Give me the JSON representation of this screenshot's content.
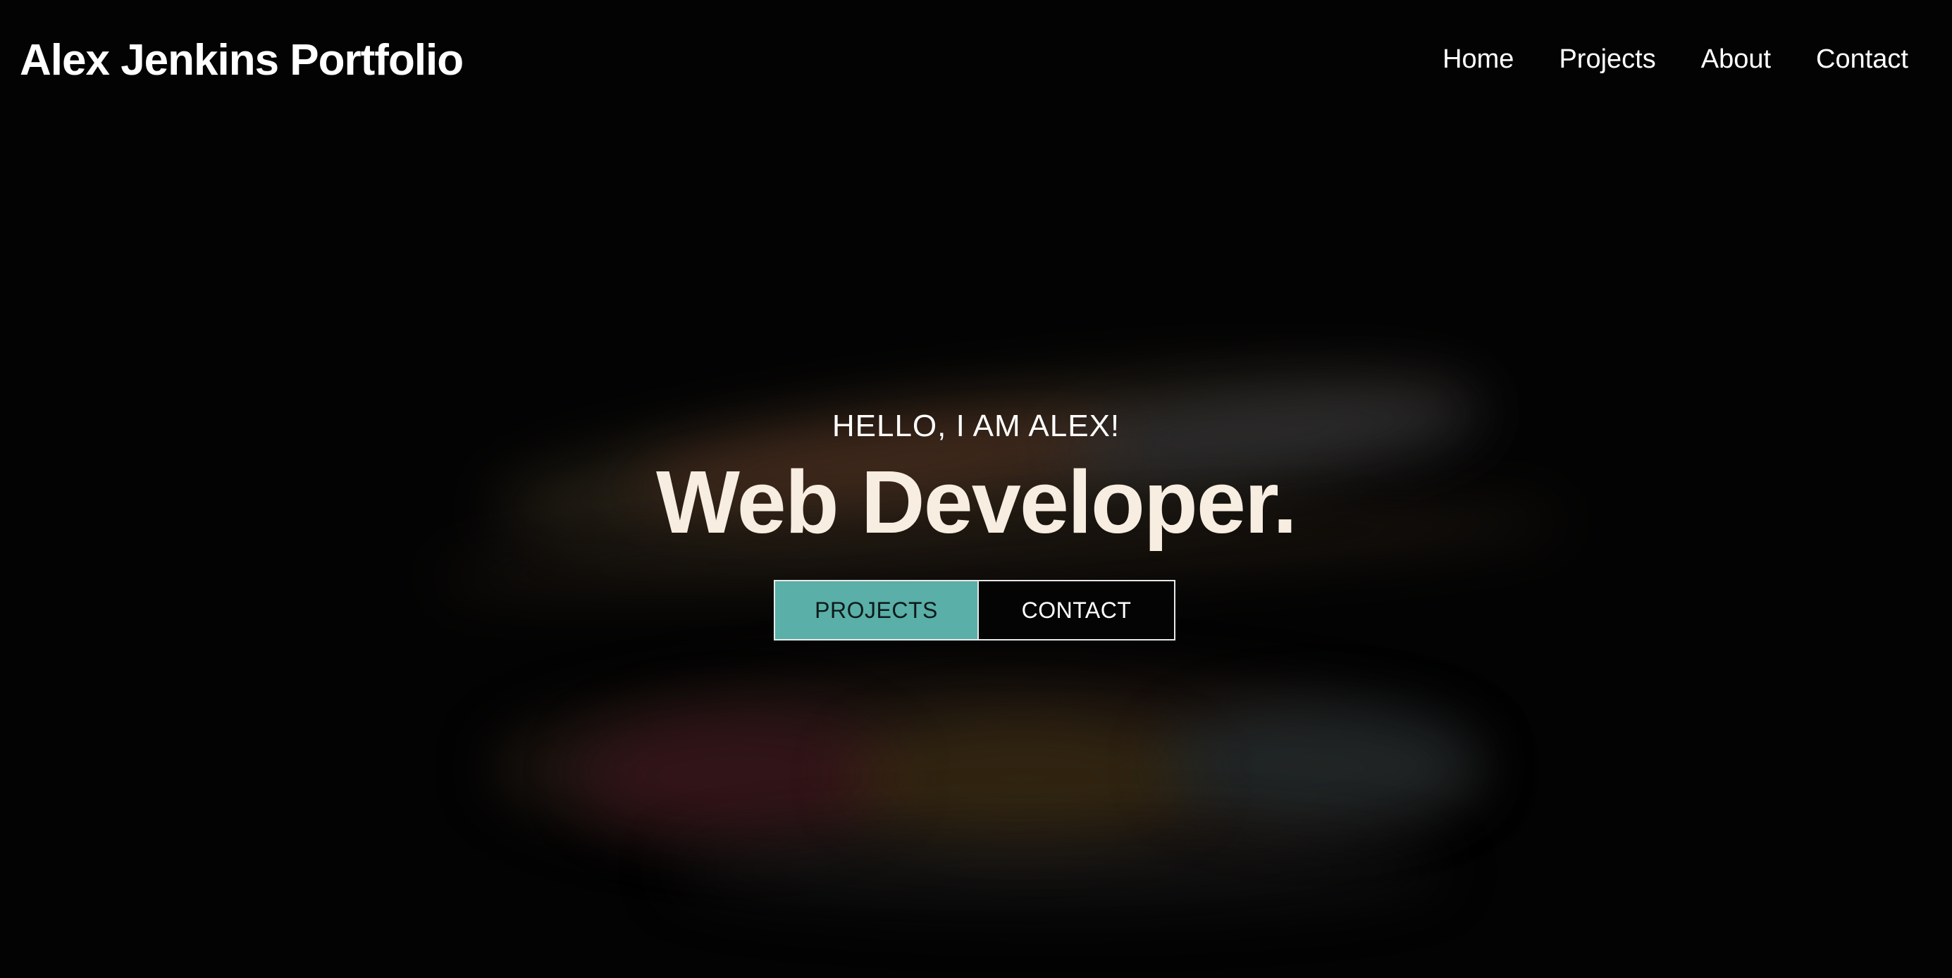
{
  "header": {
    "brand": "Alex Jenkins Portfolio",
    "nav": [
      {
        "label": "Home"
      },
      {
        "label": "Projects"
      },
      {
        "label": "About"
      },
      {
        "label": "Contact"
      }
    ]
  },
  "hero": {
    "greeting": "HELLO, I AM ALEX!",
    "title": "Web Developer.",
    "buttons": {
      "projects": "PROJECTS",
      "contact": "CONTACT"
    }
  },
  "colors": {
    "background": "#030303",
    "accent": "#5aafa8",
    "title": "#f7ede0",
    "text": "#ffffff"
  }
}
